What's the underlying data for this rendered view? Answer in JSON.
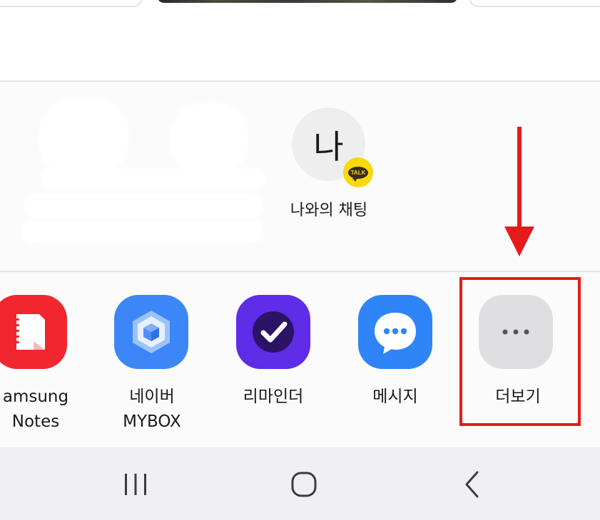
{
  "share_targets": {
    "kakao_self_chat": {
      "avatar_text": "나",
      "badge_text": "TALK",
      "label": "나와의 채팅"
    }
  },
  "apps": [
    {
      "id": "samsung-notes",
      "label_lines": [
        "amsung",
        "Notes"
      ],
      "color": "#f2262e"
    },
    {
      "id": "naver-mybox",
      "label_lines": [
        "네이버",
        "MYBOX"
      ],
      "color": "#3d86f7"
    },
    {
      "id": "reminder",
      "label_lines": [
        "리마인더"
      ],
      "color": "#5f2ce8"
    },
    {
      "id": "messages",
      "label_lines": [
        "메시지"
      ],
      "color": "#2f85f8"
    },
    {
      "id": "more",
      "label_lines": [
        "더보기"
      ],
      "color": "#dfdfe1"
    }
  ],
  "annotation": {
    "color": "#e51b1b"
  },
  "nav_bar": {
    "buttons": [
      "recents",
      "home",
      "back"
    ]
  }
}
